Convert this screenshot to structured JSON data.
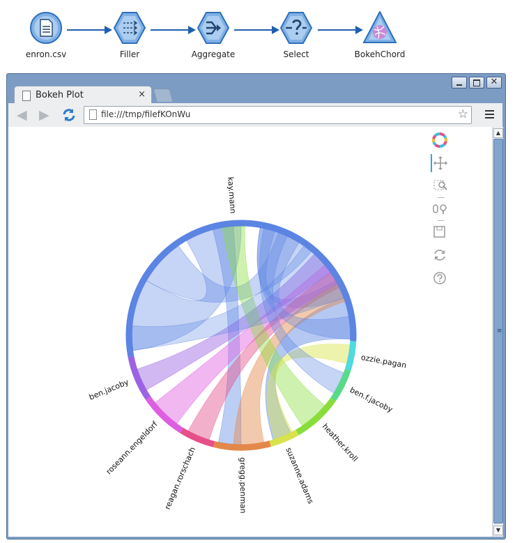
{
  "pipeline": {
    "nodes": [
      {
        "label": "enron.csv",
        "icon": "csv-source-icon"
      },
      {
        "label": "Filler",
        "icon": "filler-icon"
      },
      {
        "label": "Aggregate",
        "icon": "aggregate-icon"
      },
      {
        "label": "Select",
        "icon": "select-icon"
      },
      {
        "label": "BokehChord",
        "icon": "chord-diagram-icon"
      }
    ]
  },
  "browser": {
    "tab_title": "Bokeh Plot",
    "tab_close": "×",
    "url": "file:///tmp/filefKOnWu",
    "star": "☆"
  },
  "chart_data": {
    "type": "chord",
    "nodes": [
      "kay.mann",
      "ozzie.pagan",
      "ben.f.jacoby",
      "heather.kroll",
      "suzanne.adams",
      "gregg.penman",
      "reagan.rorschach",
      "roseann.engeldorf",
      "ben.jacoby"
    ],
    "colors": {
      "kay.mann": "#5b84e3",
      "ozzie.pagan": "#4fd9e0",
      "ben.f.jacoby": "#57db88",
      "heather.kroll": "#88dd3a",
      "suzanne.adams": "#d8e24a",
      "gregg.penman": "#e3884a",
      "reagan.rorschach": "#e54f8a",
      "roseann.engeldorf": "#dd5fe0",
      "ben.jacoby": "#9b62e4"
    }
  }
}
